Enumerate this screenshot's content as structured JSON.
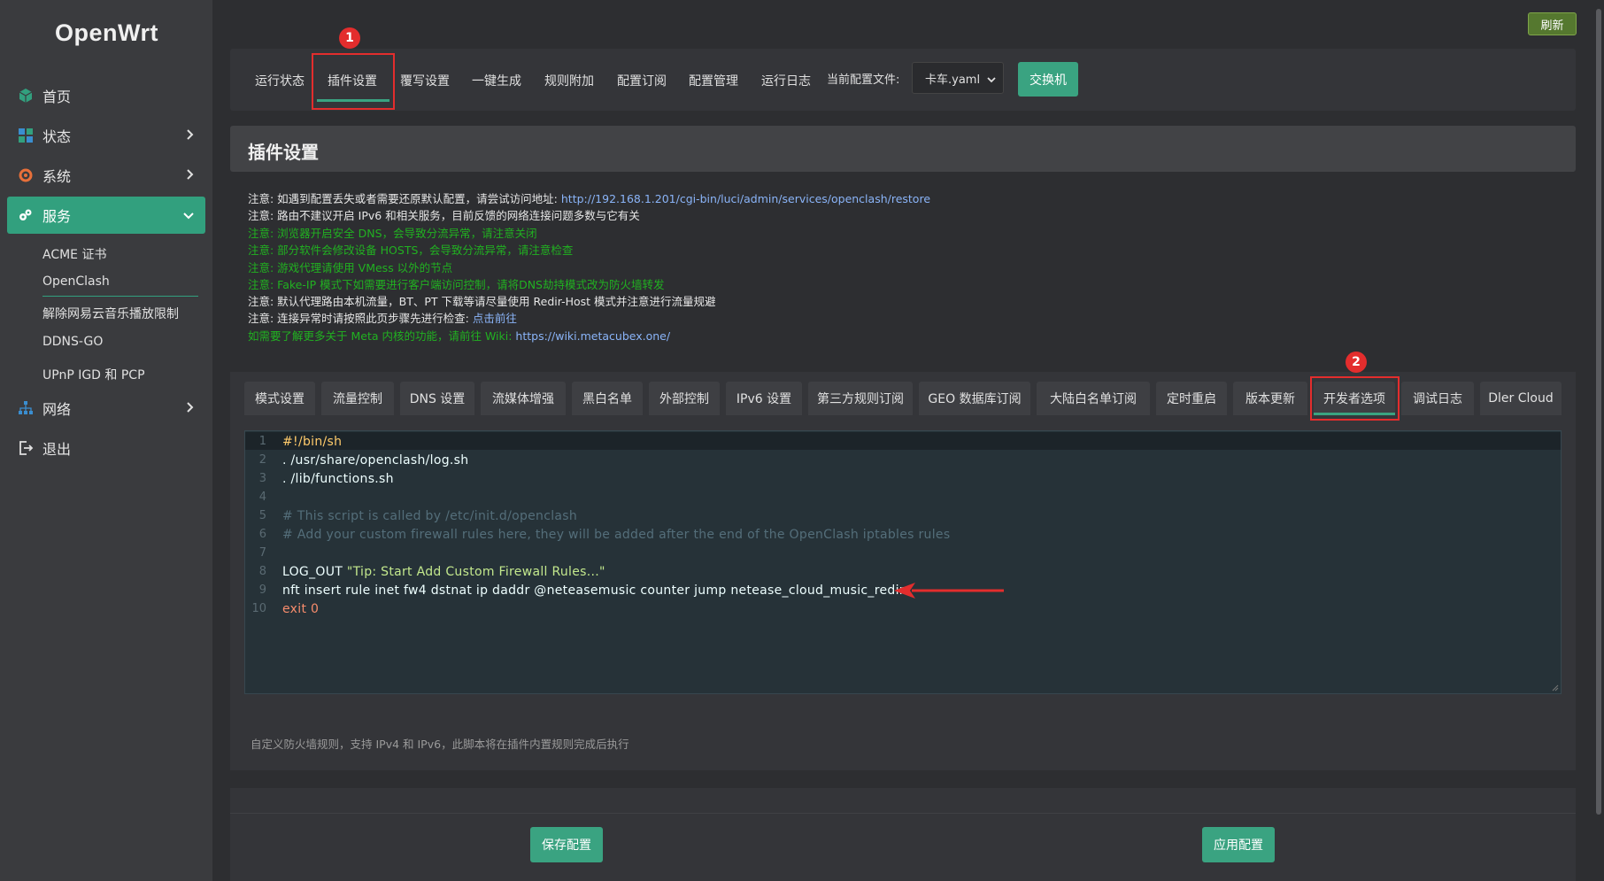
{
  "sidebar": {
    "logo": "OpenWrt",
    "items": [
      {
        "label": "首页",
        "icon": "cube-icon"
      },
      {
        "label": "状态",
        "icon": "grid-icon"
      },
      {
        "label": "系统",
        "icon": "gear-icon"
      },
      {
        "label": "服务",
        "icon": "puzzle-icon"
      },
      {
        "label": "网络",
        "icon": "network-icon"
      },
      {
        "label": "退出",
        "icon": "logout-icon"
      }
    ],
    "service_sub_items": [
      "ACME 证书",
      "OpenClash",
      "解除网易云音乐播放限制",
      "DDNS-GO",
      "UPnP IGD 和 PCP"
    ]
  },
  "topbar": {
    "refresh_label": "刷新"
  },
  "top_tabs": [
    "运行状态",
    "插件设置",
    "覆写设置",
    "一键生成",
    "规则附加",
    "配置订阅",
    "配置管理",
    "运行日志"
  ],
  "config": {
    "label": "当前配置文件:",
    "selected": "卡车.yaml",
    "switch_label": "交换机"
  },
  "annotations": {
    "badge1": "1",
    "badge2": "2"
  },
  "section_title": "插件设置",
  "notes": {
    "n1_prefix": "注意: 如遇到配置丢失或者需要还原默认配置，请尝试访问地址: ",
    "n1_link": "http://192.168.1.201/cgi-bin/luci/admin/services/openclash/restore",
    "n2": "注意: 路由不建议开启 IPv6 和相关服务，目前反馈的网络连接问题多数与它有关",
    "n3": "注意: 浏览器开启安全 DNS，会导致分流异常，请注意关闭",
    "n4": "注意: 部分软件会修改设备 HOSTS，会导致分流异常，请注意检查",
    "n5": "注意: 游戏代理请使用 VMess 以外的节点",
    "n6": "注意: Fake-IP 模式下如需要进行客户端访问控制，请将DNS劫持模式改为防火墙转发",
    "n7": "注意: 默认代理路由本机流量，BT、PT 下载等请尽量使用 Redir-Host 模式并注意进行流量规避",
    "n8_prefix": "注意: 连接异常时请按照此页步骤先进行检查: ",
    "n8_link": "点击前往",
    "n9_prefix": "如需要了解更多关于 Meta 内核的功能，请前往 Wiki: ",
    "n9_link": "https://wiki.metacubex.one/"
  },
  "sub_tabs": [
    "模式设置",
    "流量控制",
    "DNS 设置",
    "流媒体增强",
    "黑白名单",
    "外部控制",
    "IPv6 设置",
    "第三方规则订阅",
    "GEO 数据库订阅",
    "大陆白名单订阅",
    "定时重启",
    "版本更新",
    "开发者选项",
    "调试日志",
    "Dler Cloud"
  ],
  "editor": {
    "line_numbers": [
      "1",
      "2",
      "3",
      "4",
      "5",
      "6",
      "7",
      "8",
      "9",
      "10"
    ],
    "l1": "#!/bin/sh",
    "l2": ". /usr/share/openclash/log.sh",
    "l3": ". /lib/functions.sh",
    "l5": "# This script is called by /etc/init.d/openclash",
    "l6": "# Add your custom firewall rules here, they will be added after the end of the OpenClash iptables rules",
    "l8_cmd": "LOG_OUT ",
    "l8_str": "\"Tip: Start Add Custom Firewall Rules...\"",
    "l9": "nft insert rule inet fw4 dstnat ip daddr @neteasemusic counter jump netease_cloud_music_redir",
    "l10_kw": "exit",
    "l10_num": "0"
  },
  "help_text": "自定义防火墙规则，支持 IPv4 和 IPv6，此脚本将在插件内置规则完成后执行",
  "actions": {
    "save_label": "保存配置",
    "apply_label": "应用配置"
  },
  "colors": {
    "accent": "#3aa381",
    "annotation_red": "#e32d2d",
    "note_green": "#21b121"
  }
}
